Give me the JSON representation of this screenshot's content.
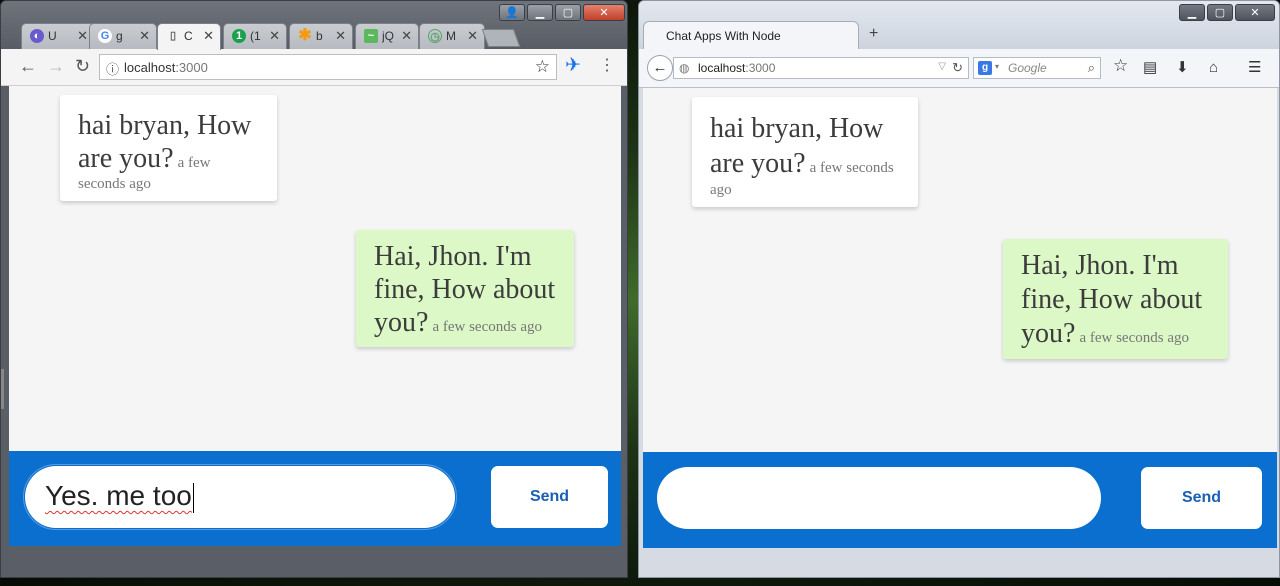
{
  "left_window": {
    "tabs": [
      {
        "icon": "spinner-icon",
        "label": "U",
        "color": "#6a5acd"
      },
      {
        "icon": "google-icon",
        "label": "g",
        "color": "#4285f4"
      },
      {
        "icon": "page-icon",
        "label": "C",
        "color": "#777777",
        "active": true
      },
      {
        "icon": "badge-one-icon",
        "label": "(1",
        "color": "#1aa14b"
      },
      {
        "icon": "asterisk-icon",
        "label": "b",
        "color": "#f39c12"
      },
      {
        "icon": "jquery-icon",
        "label": "jQ",
        "color": "#5cb85c"
      },
      {
        "icon": "clock-icon",
        "label": "M",
        "color": "#5aa469"
      }
    ],
    "url_host": "localhost",
    "url_port": ":3000",
    "messages": [
      {
        "side": "in",
        "text": "hai bryan, How are you?",
        "time": "a few seconds ago"
      },
      {
        "side": "out",
        "text": "Hai, Jhon. I'm fine, How about you?",
        "time": "a few seconds ago"
      }
    ],
    "input_value": "Yes. me too",
    "send_label": "Send"
  },
  "right_window": {
    "tab_title": "Chat Apps With Node",
    "url_host": "localhost",
    "url_port": ":3000",
    "search_placeholder": "Google",
    "messages": [
      {
        "side": "in",
        "text": "hai bryan, How are you?",
        "time": "a few seconds ago"
      },
      {
        "side": "out",
        "text": "Hai, Jhon. I'm fine, How about you?",
        "time": "a few seconds ago"
      }
    ],
    "input_value": "",
    "send_label": "Send"
  },
  "colors": {
    "composer_bg": "#0a6fce",
    "incoming_bubble": "#ffffff",
    "outgoing_bubble": "#dcf8c6",
    "send_text": "#1a5fb4"
  }
}
